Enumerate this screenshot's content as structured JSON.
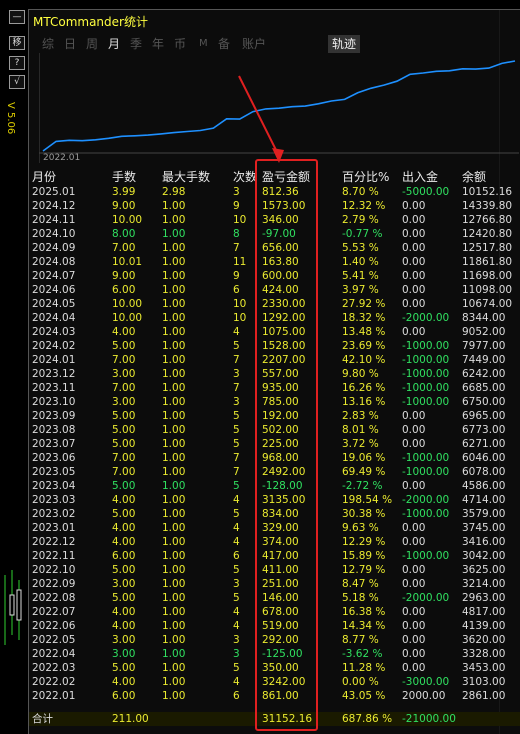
{
  "app": {
    "title": "MTCommander统计",
    "version": "V 5.06"
  },
  "side_buttons": [
    "—",
    "移",
    "?",
    "√"
  ],
  "tabs": [
    {
      "label": "综"
    },
    {
      "label": "日"
    },
    {
      "label": "周"
    },
    {
      "label": "月"
    },
    {
      "label": "季"
    },
    {
      "label": "年"
    },
    {
      "label": "币"
    },
    {
      "label": "M"
    },
    {
      "label": "备"
    },
    {
      "label": "账户"
    },
    {
      "label": "轨迹"
    }
  ],
  "active_tab": "月",
  "chart": {
    "start_label": "2022.01",
    "line_color": "#1e90ff"
  },
  "chart_data": {
    "type": "line",
    "x": [
      "2022.01",
      "2022.02",
      "2022.03",
      "2022.04",
      "2022.05",
      "2022.06",
      "2022.07",
      "2022.08",
      "2022.09",
      "2022.10",
      "2022.11",
      "2022.12",
      "2023.01",
      "2023.02",
      "2023.03",
      "2023.04",
      "2023.05",
      "2023.06",
      "2023.07",
      "2023.08",
      "2023.09",
      "2023.10",
      "2023.11",
      "2023.12",
      "2024.01",
      "2024.02",
      "2024.03",
      "2024.04",
      "2024.05",
      "2024.06",
      "2024.07",
      "2024.08",
      "2024.09",
      "2024.10",
      "2024.11",
      "2024.12",
      "2025.01"
    ],
    "series": [
      {
        "values": [
          861,
          4103,
          4453,
          4328,
          4620,
          5139,
          5817,
          5963,
          6214,
          6625,
          7042,
          7416,
          7745,
          8579,
          11714,
          11586,
          14078,
          15046,
          15271,
          15773,
          15965,
          16750,
          17685,
          18242,
          20449,
          21977,
          23052,
          24344,
          26674,
          27098,
          27698,
          27862,
          28518,
          28421,
          28767,
          30340,
          31152
        ]
      }
    ]
  },
  "table": {
    "headers": [
      "月份",
      "手数",
      "最大手数",
      "次数",
      "盈亏金额",
      "百分比%",
      "出入金",
      "余额"
    ],
    "rows": [
      {
        "month": "2025.01",
        "lots": "3.99",
        "max": "2.98",
        "count": "3",
        "pnl": "812.36",
        "pct": "8.70 %",
        "flow": "-5000.00",
        "bal": "10152.16",
        "neg": false,
        "flowneg": true
      },
      {
        "month": "2024.12",
        "lots": "9.00",
        "max": "1.00",
        "count": "9",
        "pnl": "1573.00",
        "pct": "12.32 %",
        "flow": "0.00",
        "bal": "14339.80",
        "neg": false,
        "flowneg": false
      },
      {
        "month": "2024.11",
        "lots": "10.00",
        "max": "1.00",
        "count": "10",
        "pnl": "346.00",
        "pct": "2.79 %",
        "flow": "0.00",
        "bal": "12766.80",
        "neg": false,
        "flowneg": false
      },
      {
        "month": "2024.10",
        "lots": "8.00",
        "max": "1.00",
        "count": "8",
        "pnl": "-97.00",
        "pct": "-0.77 %",
        "flow": "0.00",
        "bal": "12420.80",
        "neg": true,
        "flowneg": false
      },
      {
        "month": "2024.09",
        "lots": "7.00",
        "max": "1.00",
        "count": "7",
        "pnl": "656.00",
        "pct": "5.53 %",
        "flow": "0.00",
        "bal": "12517.80",
        "neg": false,
        "flowneg": false
      },
      {
        "month": "2024.08",
        "lots": "10.01",
        "max": "1.00",
        "count": "11",
        "pnl": "163.80",
        "pct": "1.40 %",
        "flow": "0.00",
        "bal": "11861.80",
        "neg": false,
        "flowneg": false
      },
      {
        "month": "2024.07",
        "lots": "9.00",
        "max": "1.00",
        "count": "9",
        "pnl": "600.00",
        "pct": "5.41 %",
        "flow": "0.00",
        "bal": "11698.00",
        "neg": false,
        "flowneg": false
      },
      {
        "month": "2024.06",
        "lots": "6.00",
        "max": "1.00",
        "count": "6",
        "pnl": "424.00",
        "pct": "3.97 %",
        "flow": "0.00",
        "bal": "11098.00",
        "neg": false,
        "flowneg": false
      },
      {
        "month": "2024.05",
        "lots": "10.00",
        "max": "1.00",
        "count": "10",
        "pnl": "2330.00",
        "pct": "27.92 %",
        "flow": "0.00",
        "bal": "10674.00",
        "neg": false,
        "flowneg": false
      },
      {
        "month": "2024.04",
        "lots": "10.00",
        "max": "1.00",
        "count": "10",
        "pnl": "1292.00",
        "pct": "18.32 %",
        "flow": "-2000.00",
        "bal": "8344.00",
        "neg": false,
        "flowneg": true
      },
      {
        "month": "2024.03",
        "lots": "4.00",
        "max": "1.00",
        "count": "4",
        "pnl": "1075.00",
        "pct": "13.48 %",
        "flow": "0.00",
        "bal": "9052.00",
        "neg": false,
        "flowneg": false
      },
      {
        "month": "2024.02",
        "lots": "5.00",
        "max": "1.00",
        "count": "5",
        "pnl": "1528.00",
        "pct": "23.69 %",
        "flow": "-1000.00",
        "bal": "7977.00",
        "neg": false,
        "flowneg": true
      },
      {
        "month": "2024.01",
        "lots": "7.00",
        "max": "1.00",
        "count": "7",
        "pnl": "2207.00",
        "pct": "42.10 %",
        "flow": "-1000.00",
        "bal": "7449.00",
        "neg": false,
        "flowneg": true
      },
      {
        "month": "2023.12",
        "lots": "3.00",
        "max": "1.00",
        "count": "3",
        "pnl": "557.00",
        "pct": "9.80 %",
        "flow": "-1000.00",
        "bal": "6242.00",
        "neg": false,
        "flowneg": true
      },
      {
        "month": "2023.11",
        "lots": "7.00",
        "max": "1.00",
        "count": "7",
        "pnl": "935.00",
        "pct": "16.26 %",
        "flow": "-1000.00",
        "bal": "6685.00",
        "neg": false,
        "flowneg": true
      },
      {
        "month": "2023.10",
        "lots": "3.00",
        "max": "1.00",
        "count": "3",
        "pnl": "785.00",
        "pct": "13.16 %",
        "flow": "-1000.00",
        "bal": "6750.00",
        "neg": false,
        "flowneg": true
      },
      {
        "month": "2023.09",
        "lots": "5.00",
        "max": "1.00",
        "count": "5",
        "pnl": "192.00",
        "pct": "2.83 %",
        "flow": "0.00",
        "bal": "6965.00",
        "neg": false,
        "flowneg": false
      },
      {
        "month": "2023.08",
        "lots": "5.00",
        "max": "1.00",
        "count": "5",
        "pnl": "502.00",
        "pct": "8.01 %",
        "flow": "0.00",
        "bal": "6773.00",
        "neg": false,
        "flowneg": false
      },
      {
        "month": "2023.07",
        "lots": "5.00",
        "max": "1.00",
        "count": "5",
        "pnl": "225.00",
        "pct": "3.72 %",
        "flow": "0.00",
        "bal": "6271.00",
        "neg": false,
        "flowneg": false
      },
      {
        "month": "2023.06",
        "lots": "7.00",
        "max": "1.00",
        "count": "7",
        "pnl": "968.00",
        "pct": "19.06 %",
        "flow": "-1000.00",
        "bal": "6046.00",
        "neg": false,
        "flowneg": true
      },
      {
        "month": "2023.05",
        "lots": "7.00",
        "max": "1.00",
        "count": "7",
        "pnl": "2492.00",
        "pct": "69.49 %",
        "flow": "-1000.00",
        "bal": "6078.00",
        "neg": false,
        "flowneg": true
      },
      {
        "month": "2023.04",
        "lots": "5.00",
        "max": "1.00",
        "count": "5",
        "pnl": "-128.00",
        "pct": "-2.72 %",
        "flow": "0.00",
        "bal": "4586.00",
        "neg": true,
        "flowneg": false
      },
      {
        "month": "2023.03",
        "lots": "4.00",
        "max": "1.00",
        "count": "4",
        "pnl": "3135.00",
        "pct": "198.54 %",
        "flow": "-2000.00",
        "bal": "4714.00",
        "neg": false,
        "flowneg": true
      },
      {
        "month": "2023.02",
        "lots": "5.00",
        "max": "1.00",
        "count": "5",
        "pnl": "834.00",
        "pct": "30.38 %",
        "flow": "-1000.00",
        "bal": "3579.00",
        "neg": false,
        "flowneg": true
      },
      {
        "month": "2023.01",
        "lots": "4.00",
        "max": "1.00",
        "count": "4",
        "pnl": "329.00",
        "pct": "9.63 %",
        "flow": "0.00",
        "bal": "3745.00",
        "neg": false,
        "flowneg": false
      },
      {
        "month": "2022.12",
        "lots": "4.00",
        "max": "1.00",
        "count": "4",
        "pnl": "374.00",
        "pct": "12.29 %",
        "flow": "0.00",
        "bal": "3416.00",
        "neg": false,
        "flowneg": false
      },
      {
        "month": "2022.11",
        "lots": "6.00",
        "max": "1.00",
        "count": "6",
        "pnl": "417.00",
        "pct": "15.89 %",
        "flow": "-1000.00",
        "bal": "3042.00",
        "neg": false,
        "flowneg": true
      },
      {
        "month": "2022.10",
        "lots": "5.00",
        "max": "1.00",
        "count": "5",
        "pnl": "411.00",
        "pct": "12.79 %",
        "flow": "0.00",
        "bal": "3625.00",
        "neg": false,
        "flowneg": false
      },
      {
        "month": "2022.09",
        "lots": "3.00",
        "max": "1.00",
        "count": "3",
        "pnl": "251.00",
        "pct": "8.47 %",
        "flow": "0.00",
        "bal": "3214.00",
        "neg": false,
        "flowneg": false
      },
      {
        "month": "2022.08",
        "lots": "5.00",
        "max": "1.00",
        "count": "5",
        "pnl": "146.00",
        "pct": "5.18 %",
        "flow": "-2000.00",
        "bal": "2963.00",
        "neg": false,
        "flowneg": true
      },
      {
        "month": "2022.07",
        "lots": "4.00",
        "max": "1.00",
        "count": "4",
        "pnl": "678.00",
        "pct": "16.38 %",
        "flow": "0.00",
        "bal": "4817.00",
        "neg": false,
        "flowneg": false
      },
      {
        "month": "2022.06",
        "lots": "4.00",
        "max": "1.00",
        "count": "4",
        "pnl": "519.00",
        "pct": "14.34 %",
        "flow": "0.00",
        "bal": "4139.00",
        "neg": false,
        "flowneg": false
      },
      {
        "month": "2022.05",
        "lots": "3.00",
        "max": "1.00",
        "count": "3",
        "pnl": "292.00",
        "pct": "8.77 %",
        "flow": "0.00",
        "bal": "3620.00",
        "neg": false,
        "flowneg": false
      },
      {
        "month": "2022.04",
        "lots": "3.00",
        "max": "1.00",
        "count": "3",
        "pnl": "-125.00",
        "pct": "-3.62 %",
        "flow": "0.00",
        "bal": "3328.00",
        "neg": true,
        "flowneg": false
      },
      {
        "month": "2022.03",
        "lots": "5.00",
        "max": "1.00",
        "count": "5",
        "pnl": "350.00",
        "pct": "11.28 %",
        "flow": "0.00",
        "bal": "3453.00",
        "neg": false,
        "flowneg": false
      },
      {
        "month": "2022.02",
        "lots": "4.00",
        "max": "1.00",
        "count": "4",
        "pnl": "3242.00",
        "pct": "0.00 %",
        "flow": "-3000.00",
        "bal": "3103.00",
        "neg": false,
        "flowneg": true
      },
      {
        "month": "2022.01",
        "lots": "6.00",
        "max": "1.00",
        "count": "6",
        "pnl": "861.00",
        "pct": "43.05 %",
        "flow": "2000.00",
        "bal": "2861.00",
        "neg": false,
        "flowneg": false
      }
    ],
    "total": {
      "label": "合计",
      "lots": "211.00",
      "pnl": "31152.16",
      "pct": "687.86 %",
      "flow": "-21000.00"
    }
  },
  "colors": {
    "value": "#eaea30",
    "negative": "#30e060",
    "highlight": "#e02020",
    "line": "#1e90ff"
  }
}
